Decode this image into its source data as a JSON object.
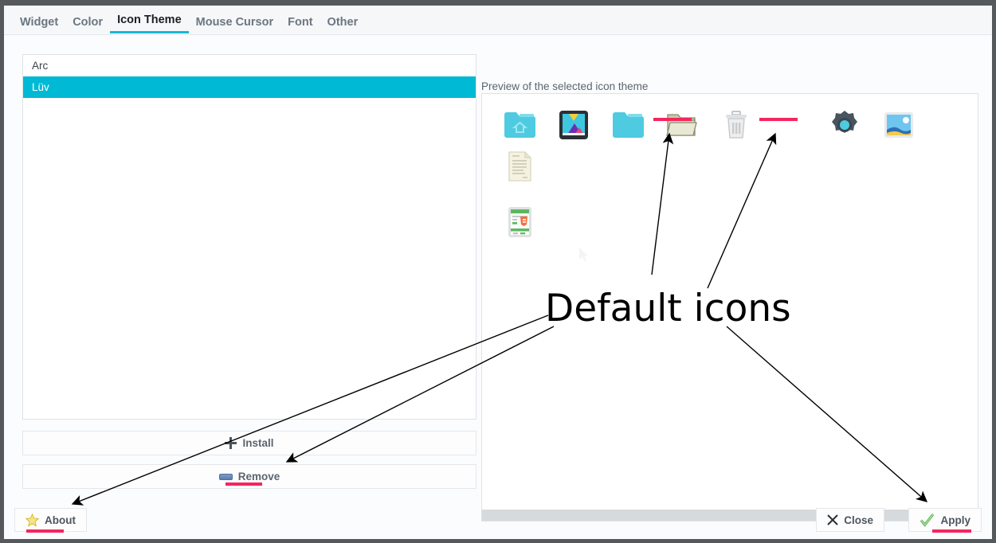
{
  "window": {
    "tabs": [
      {
        "label": "Widget",
        "active": false
      },
      {
        "label": "Color",
        "active": false
      },
      {
        "label": "Icon Theme",
        "active": true
      },
      {
        "label": "Mouse Cursor",
        "active": false
      },
      {
        "label": "Font",
        "active": false
      },
      {
        "label": "Other",
        "active": false
      }
    ]
  },
  "theme_list": {
    "items": [
      {
        "name": "Arc",
        "selected": false
      },
      {
        "name": "Lüv",
        "selected": true
      }
    ]
  },
  "list_actions": {
    "install_label": "Install",
    "install_icon": "plus-icon",
    "remove_label": "Remove",
    "remove_icon": "minus-icon"
  },
  "preview": {
    "label": "Preview of the selected icon theme",
    "icons": [
      {
        "name": "user-home-folder-icon",
        "kind": "folder-home",
        "default": false
      },
      {
        "name": "wallpaper-image-icon",
        "kind": "wallpaper",
        "default": false
      },
      {
        "name": "folder-icon",
        "kind": "folder",
        "default": false
      },
      {
        "name": "open-folder-icon",
        "kind": "folder-open",
        "default": true
      },
      {
        "name": "trash-icon",
        "kind": "trash",
        "default": false
      },
      {
        "name": "missing-icon",
        "kind": "blank",
        "default": true
      },
      {
        "name": "settings-gear-icon",
        "kind": "gear",
        "default": false
      },
      {
        "name": "photo-image-icon",
        "kind": "photo",
        "default": false
      },
      {
        "name": "text-document-icon",
        "kind": "document",
        "default": false
      },
      {
        "name": "html-document-icon",
        "kind": "html-doc",
        "default": false
      }
    ]
  },
  "footer": {
    "about_label": "About",
    "about_icon": "star-icon",
    "close_label": "Close",
    "close_icon": "x-icon",
    "apply_label": "Apply",
    "apply_icon": "check-icon"
  },
  "annotation": {
    "text": "Default icons",
    "highlight_color": "#f4265e",
    "targets": [
      "open-folder-icon",
      "missing-icon",
      "remove-button",
      "about-button",
      "apply-button"
    ]
  },
  "colors": {
    "selection": "#00b9d4",
    "tab_accent": "#17b8d4",
    "annotation_red": "#f4265e",
    "window_border": "#55595c"
  }
}
